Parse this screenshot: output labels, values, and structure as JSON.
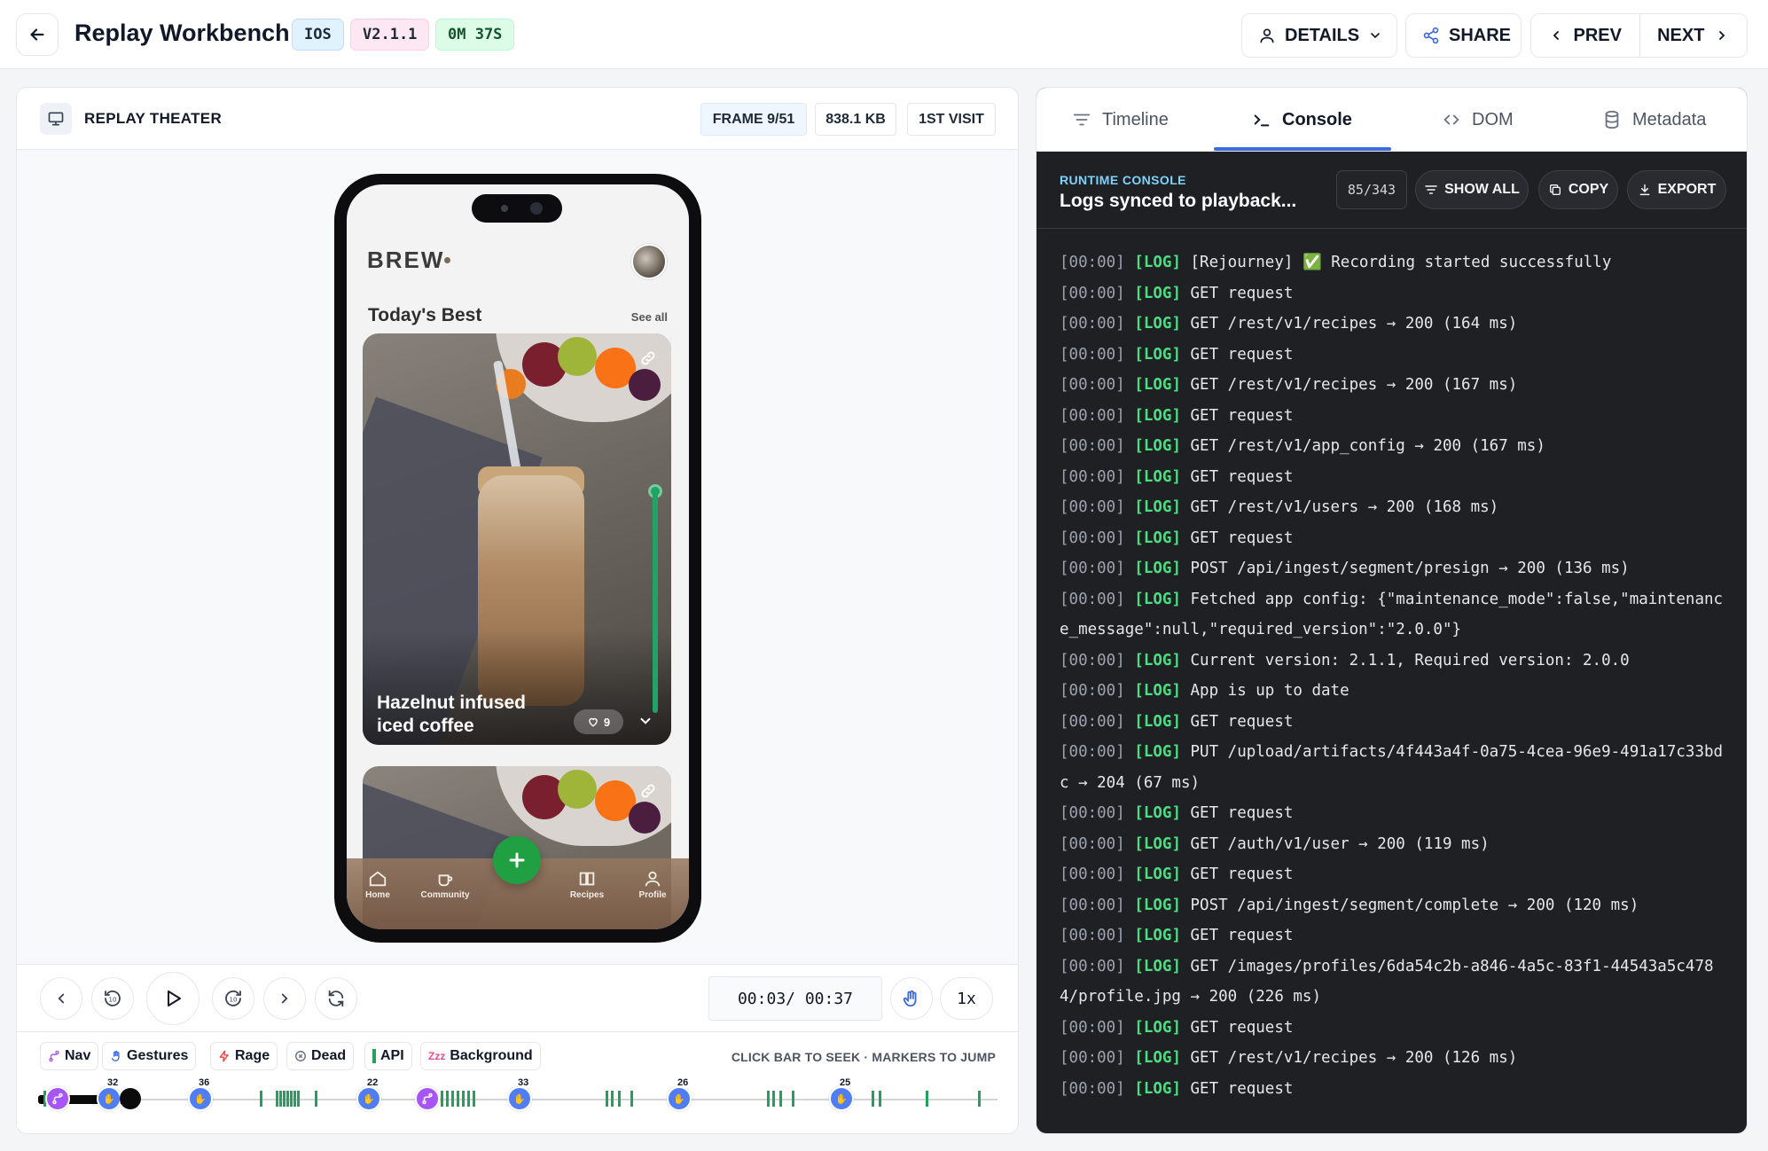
{
  "header": {
    "title": "Replay Workbench",
    "badges": {
      "platform": "IOS",
      "version": "V2.1.1",
      "duration": "0M 37S"
    },
    "details_label": "DETAILS",
    "share_label": "SHARE",
    "prev_label": "PREV",
    "next_label": "NEXT"
  },
  "theater": {
    "title": "REPLAY THEATER",
    "frame": "FRAME 9/51",
    "size": "838.1 KB",
    "visit": "1ST VISIT"
  },
  "app_screen": {
    "brand": "BREW",
    "section_title": "Today's Best",
    "see_all": "See all",
    "card_title": "Hazelnut infused iced coffee",
    "likes": "9",
    "tabs": [
      "Home",
      "Community",
      "Recipes",
      "Profile"
    ]
  },
  "controls": {
    "time": "00:03/ 00:37",
    "speed": "1x"
  },
  "filters": {
    "chips": [
      "Nav",
      "Gestures",
      "Rage",
      "Dead",
      "API",
      "Background"
    ],
    "hint": "CLICK BAR TO SEEK · MARKERS TO JUMP",
    "marker_labels": [
      "32",
      "36",
      "22",
      "33",
      "26",
      "25"
    ]
  },
  "right_panel": {
    "tabs": [
      "Timeline",
      "Console",
      "DOM",
      "Metadata"
    ],
    "active_tab": "Console",
    "console": {
      "kicker": "RUNTIME CONSOLE",
      "title": "Logs synced to playback...",
      "count": "85/343",
      "show_all": "SHOW ALL",
      "copy": "COPY",
      "export": "EXPORT",
      "logs": [
        {
          "ts": "[00:00]",
          "lvl": "[LOG]",
          "msg": "[Rejourney] ✅ Recording started successfully"
        },
        {
          "ts": "[00:00]",
          "lvl": "[LOG]",
          "msg": "GET request"
        },
        {
          "ts": "[00:00]",
          "lvl": "[LOG]",
          "msg": "GET /rest/v1/recipes → 200 (164 ms)"
        },
        {
          "ts": "[00:00]",
          "lvl": "[LOG]",
          "msg": "GET request"
        },
        {
          "ts": "[00:00]",
          "lvl": "[LOG]",
          "msg": "GET /rest/v1/recipes → 200 (167 ms)"
        },
        {
          "ts": "[00:00]",
          "lvl": "[LOG]",
          "msg": "GET request"
        },
        {
          "ts": "[00:00]",
          "lvl": "[LOG]",
          "msg": "GET /rest/v1/app_config → 200 (167 ms)"
        },
        {
          "ts": "[00:00]",
          "lvl": "[LOG]",
          "msg": "GET request"
        },
        {
          "ts": "[00:00]",
          "lvl": "[LOG]",
          "msg": "GET /rest/v1/users → 200 (168 ms)"
        },
        {
          "ts": "[00:00]",
          "lvl": "[LOG]",
          "msg": "GET request"
        },
        {
          "ts": "[00:00]",
          "lvl": "[LOG]",
          "msg": "POST /api/ingest/segment/presign → 200 (136 ms)"
        },
        {
          "ts": "[00:00]",
          "lvl": "[LOG]",
          "msg": "Fetched app config: {\"maintenance_mode\":false,\"maintenance_message\":null,\"required_version\":\"2.0.0\"}"
        },
        {
          "ts": "[00:00]",
          "lvl": "[LOG]",
          "msg": "Current version: 2.1.1, Required version: 2.0.0"
        },
        {
          "ts": "[00:00]",
          "lvl": "[LOG]",
          "msg": "App is up to date"
        },
        {
          "ts": "[00:00]",
          "lvl": "[LOG]",
          "msg": "GET request"
        },
        {
          "ts": "[00:00]",
          "lvl": "[LOG]",
          "msg": "PUT /upload/artifacts/4f443a4f-0a75-4cea-96e9-491a17c33bdc → 204 (67 ms)"
        },
        {
          "ts": "[00:00]",
          "lvl": "[LOG]",
          "msg": "GET request"
        },
        {
          "ts": "[00:00]",
          "lvl": "[LOG]",
          "msg": "GET /auth/v1/user → 200 (119 ms)"
        },
        {
          "ts": "[00:00]",
          "lvl": "[LOG]",
          "msg": "GET request"
        },
        {
          "ts": "[00:00]",
          "lvl": "[LOG]",
          "msg": "POST /api/ingest/segment/complete → 200 (120 ms)"
        },
        {
          "ts": "[00:00]",
          "lvl": "[LOG]",
          "msg": "GET request"
        },
        {
          "ts": "[00:00]",
          "lvl": "[LOG]",
          "msg": "GET /images/profiles/6da54c2b-a846-4a5c-83f1-44543a5c4784/profile.jpg → 200 (226 ms)"
        },
        {
          "ts": "[00:00]",
          "lvl": "[LOG]",
          "msg": "GET request"
        },
        {
          "ts": "[00:00]",
          "lvl": "[LOG]",
          "msg": "GET /rest/v1/recipes → 200 (126 ms)"
        },
        {
          "ts": "[00:00]",
          "lvl": "[LOG]",
          "msg": "GET request"
        }
      ]
    }
  },
  "colors": {
    "accent": "#3b6bdc",
    "console_bg": "#1f2023",
    "log_level": "#4ade80",
    "fab": "#21a043"
  }
}
